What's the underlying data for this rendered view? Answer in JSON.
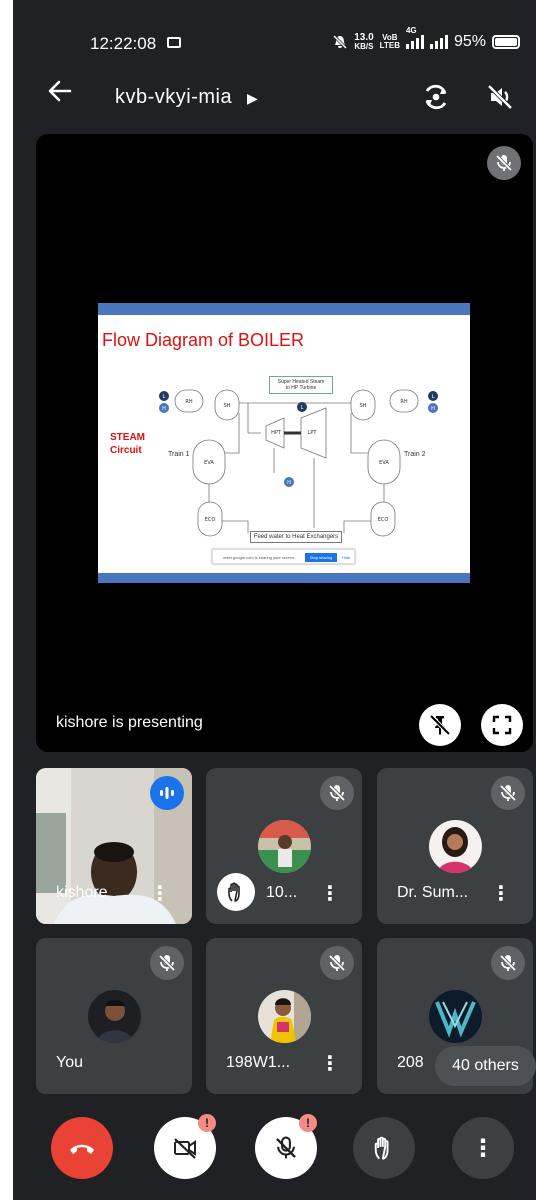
{
  "status_bar": {
    "time": "12:22:08",
    "net_speed_value": "13.0",
    "net_speed_unit": "KB/S",
    "volte_top": "VoB",
    "volte_bottom": "LTEB",
    "network": "4G",
    "battery": "95%"
  },
  "top_bar": {
    "meeting_code": "kvb-vkyi-mia"
  },
  "presentation": {
    "presenting_label": "kishore is presenting",
    "slide": {
      "title": "Flow Diagram of BOILER",
      "steam_label_1": "STEAM",
      "steam_label_2": "Circuit",
      "super_heated_1": "Super Heated Steam",
      "super_heated_2": "to HP Turbine",
      "feed_water": "Feed water to Heat Exchangers",
      "train1": "Train 1",
      "train2": "Train 2",
      "rh": "RH",
      "sh": "SH",
      "eva": "EVA",
      "eco": "ECO",
      "hpt": "HPT",
      "lpt": "LPT",
      "l": "L",
      "h": "H",
      "share_text": "meet.google.com is sharing your screen.",
      "stop_sharing": "Stop sharing",
      "hide": "Hide"
    }
  },
  "participants": [
    {
      "name": "kishore",
      "state": "speaking"
    },
    {
      "name": "10...",
      "state": "muted",
      "hand_raised": true
    },
    {
      "name": "Dr. Sum...",
      "state": "muted"
    },
    {
      "name": "You",
      "state": "muted"
    },
    {
      "name": "198W1...",
      "state": "muted"
    },
    {
      "name": "208",
      "state": "muted"
    }
  ],
  "others_label": "40 others",
  "colors": {
    "background": "#202124",
    "tile": "#3c4043",
    "end_call": "#ea4335",
    "speaking": "#1a73e8",
    "alert_badge": "#f28b82"
  },
  "icons": {
    "back": "arrow-left-icon",
    "switch_camera": "switch-camera-icon",
    "speaker": "speaker-off-icon",
    "mic": "mic-off-icon",
    "unpin": "unpin-icon",
    "fullscreen": "fullscreen-icon",
    "end_call": "phone-hangup-icon",
    "camera": "camera-off-icon",
    "raise_hand": "hand-icon",
    "more": "more-vert-icon"
  },
  "badges": {
    "alert": "!"
  }
}
